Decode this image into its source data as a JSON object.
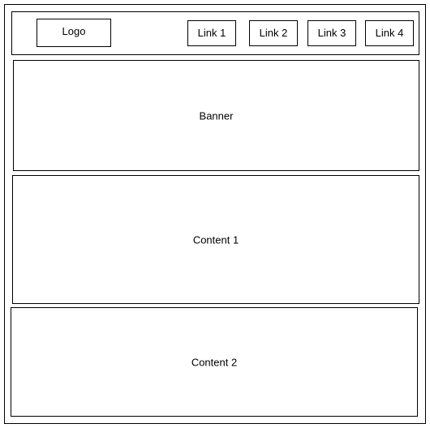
{
  "header": {
    "logo_label": "Logo",
    "links": [
      {
        "label": "Link 1"
      },
      {
        "label": "Link 2"
      },
      {
        "label": "Link 3"
      },
      {
        "label": "Link 4"
      }
    ]
  },
  "banner": {
    "label": "Banner"
  },
  "content_1": {
    "label": "Content 1"
  },
  "content_2": {
    "label": "Content 2"
  }
}
